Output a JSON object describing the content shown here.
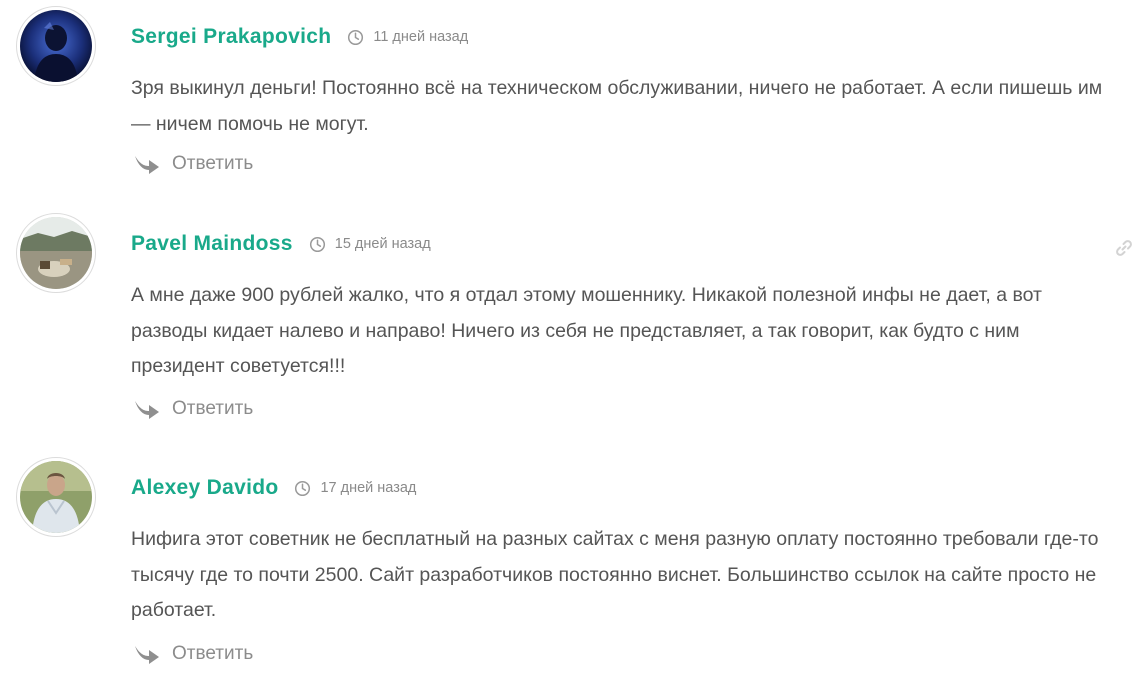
{
  "colors": {
    "author": "#19a98a",
    "body_text": "#555555",
    "muted": "#8a8a8a",
    "avatar_border": "#dcdcdc"
  },
  "comments": [
    {
      "author": "Sergei Prakapovich",
      "time": "11 дней назад",
      "text": "Зря выкинул деньги! Постоянно всё на техническом обслуживании, ничего не работает. А если пишешь им — ничем помочь не могут.",
      "reply_label": "Ответить",
      "avatar_icon": "user-photo-avatar",
      "time_icon": "clock-icon",
      "reply_icon": "reply-arrow-icon"
    },
    {
      "author": "Pavel Maindoss",
      "time": "15 дней назад",
      "text": "А мне даже 900 рублей жалко, что я отдал этому мошеннику. Никакой полезной инфы не дает, а вот разводы кидает налево и направо! Ничего из себя не представляет, а так говорит, как будто с ним президент советуется!!!",
      "reply_label": "Ответить",
      "avatar_icon": "user-photo-avatar",
      "time_icon": "clock-icon",
      "reply_icon": "reply-arrow-icon",
      "permalink_icon": "link-icon"
    },
    {
      "author": "Alexey Davido",
      "time": "17 дней назад",
      "text": "Нифига этот советник не бесплатный на разных сайтах с меня разную оплату постоянно требовали где-то тысячу где то почти 2500. Сайт разработчиков постоянно виснет. Большинство ссылок на сайте просто не работает.",
      "reply_label": "Ответить",
      "avatar_icon": "user-photo-avatar",
      "time_icon": "clock-icon",
      "reply_icon": "reply-arrow-icon"
    }
  ]
}
